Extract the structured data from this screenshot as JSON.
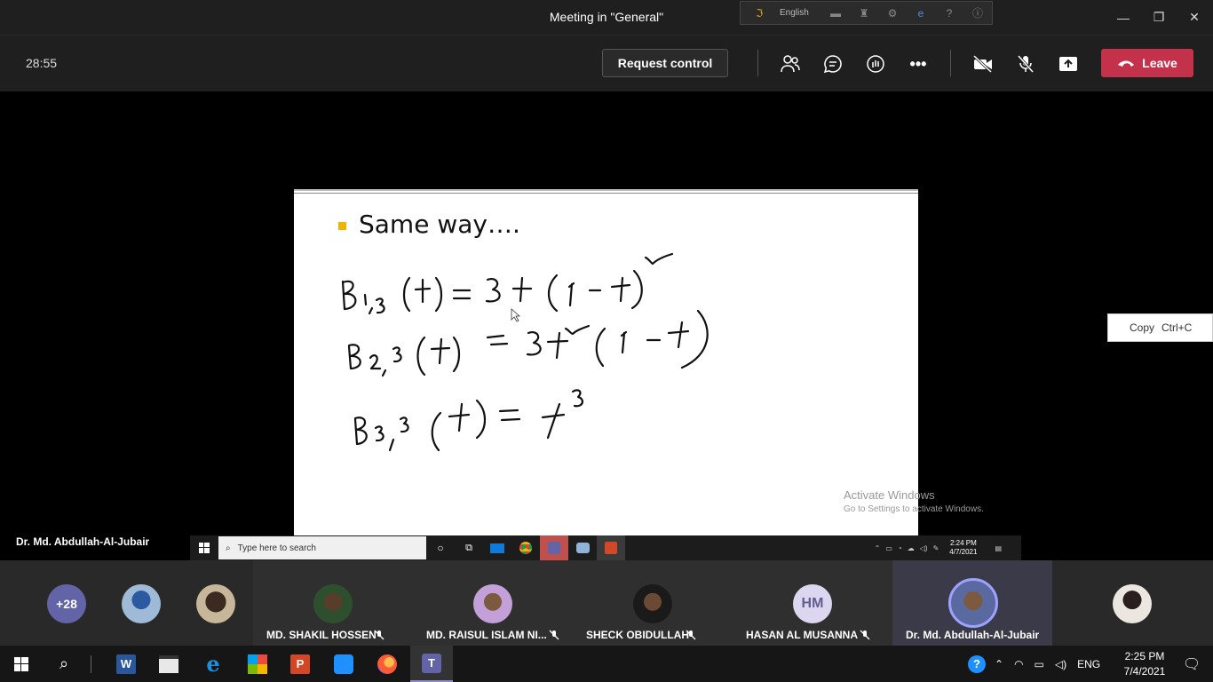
{
  "window": {
    "title": "Meeting in \"General\""
  },
  "langbar": {
    "label": "English"
  },
  "toolbar": {
    "timer": "28:55",
    "request_control": "Request control",
    "leave": "Leave"
  },
  "slide": {
    "heading": "Same way….",
    "equations": [
      "B1,3(t) = 3t(1-t)²",
      "B2,3(t) = 3t²(1-t)",
      "B3,3(t) = t³"
    ]
  },
  "watermark": {
    "line1": "Activate Windows",
    "line2": "Go to Settings to activate Windows."
  },
  "context_menu": {
    "copy": "Copy",
    "shortcut": "Ctrl+C"
  },
  "presenter_name": "Dr. Md. Abdullah-Al-Jubair",
  "inner_taskbar": {
    "search_placeholder": "Type here to search",
    "time": "2:24 PM",
    "date": "4/7/2021"
  },
  "gallery": {
    "more_count": "+28",
    "participants": [
      {
        "name": "MD. SHAKIL HOSSEN"
      },
      {
        "name": "MD. RAISUL ISLAM NI..."
      },
      {
        "name": "SHECK OBIDULLAH"
      },
      {
        "name": "HASAN AL MUSANNA",
        "initials": "HM"
      },
      {
        "name": "Dr. Md. Abdullah-Al-Jubair"
      }
    ]
  },
  "os_taskbar": {
    "lang": "ENG",
    "time": "2:25 PM",
    "date": "7/4/2021"
  },
  "colors": {
    "accent": "#6264a7",
    "leave": "#c4314b",
    "bullet": "#f0b400"
  }
}
